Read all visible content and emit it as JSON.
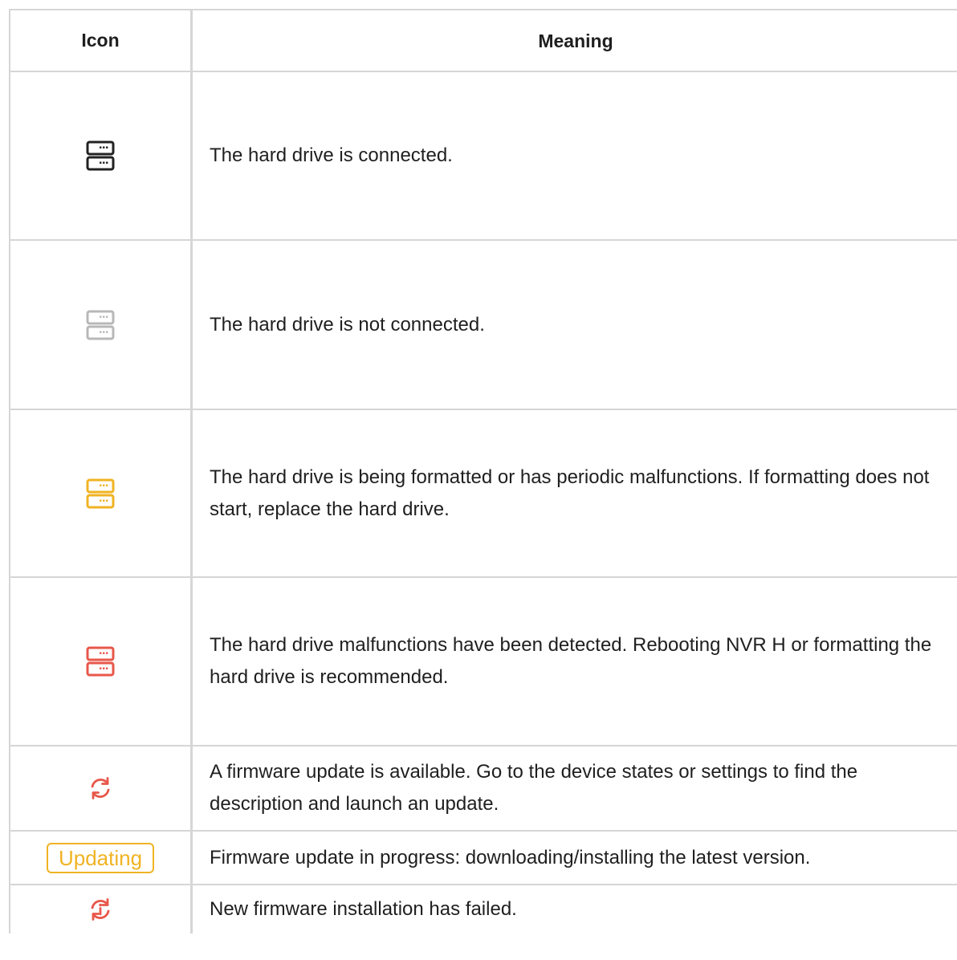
{
  "header": {
    "icon_col": "Icon",
    "meaning_col": "Meaning"
  },
  "rows": [
    {
      "icon": "hard-drive-connected-icon",
      "color": "#222222",
      "text": "The hard drive is connected."
    },
    {
      "icon": "hard-drive-not-connected-icon",
      "color": "#b8b8b8",
      "text": "The hard drive is not connected."
    },
    {
      "icon": "hard-drive-formatting-icon",
      "color": "#f0b323",
      "text": "The hard drive is being formatted or has periodic malfunctions. If formatting does not start, replace the hard drive."
    },
    {
      "icon": "hard-drive-malfunction-icon",
      "color": "#e8574a",
      "text": "The hard drive malfunctions have been detected. Rebooting NVR H or formatting the hard drive is recommended."
    },
    {
      "icon": "firmware-update-available-icon",
      "color": "#e8574a",
      "text": "A firmware update is available. Go to the device states or settings to find the description and launch an update."
    },
    {
      "badge": "Updating",
      "color": "#f0b323",
      "text": "Firmware update in progress: downloading/installing the latest version."
    },
    {
      "icon": "firmware-update-failed-icon",
      "color": "#e8574a",
      "text": "New firmware installation has failed."
    }
  ]
}
